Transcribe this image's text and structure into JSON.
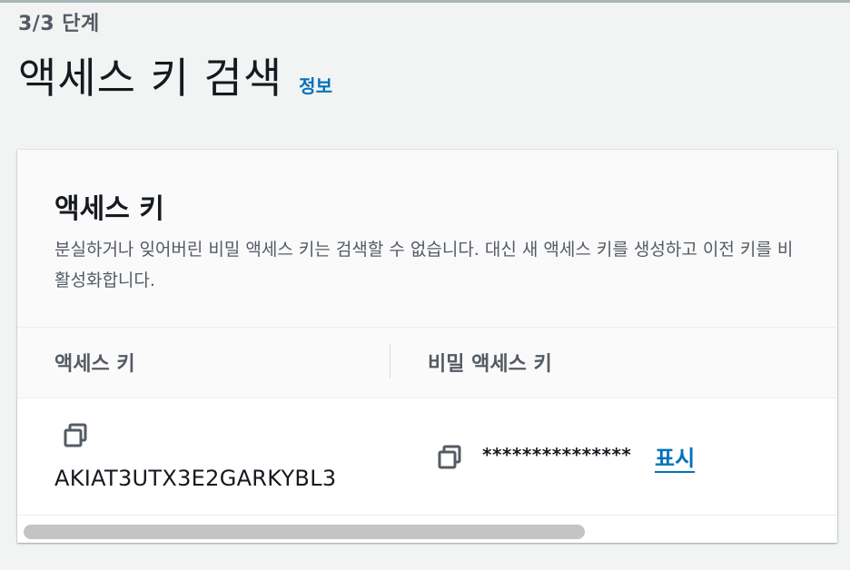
{
  "header": {
    "step": "3/3 단계",
    "title": "액세스 키 검색",
    "info_link": "정보"
  },
  "panel": {
    "title": "액세스 키",
    "description": "분실하거나 잊어버린 비밀 액세스 키는 검색할 수 없습니다. 대신 새 액세스 키를 생성하고 이전 키를 비활성화합니다."
  },
  "table": {
    "columns": [
      "액세스 키",
      "비밀 액세스 키"
    ],
    "rows": [
      {
        "access_key": "AKIAT3UTX3E2GARKYBL3",
        "secret_key_masked": "***************",
        "show_label": "표시"
      }
    ]
  },
  "icons": {
    "copy_access_key": "copy-icon",
    "copy_secret_key": "copy-icon"
  },
  "colors": {
    "link": "#0073bb",
    "background": "#f2f3f3",
    "panel": "#ffffff",
    "muted_text": "#545b64"
  }
}
